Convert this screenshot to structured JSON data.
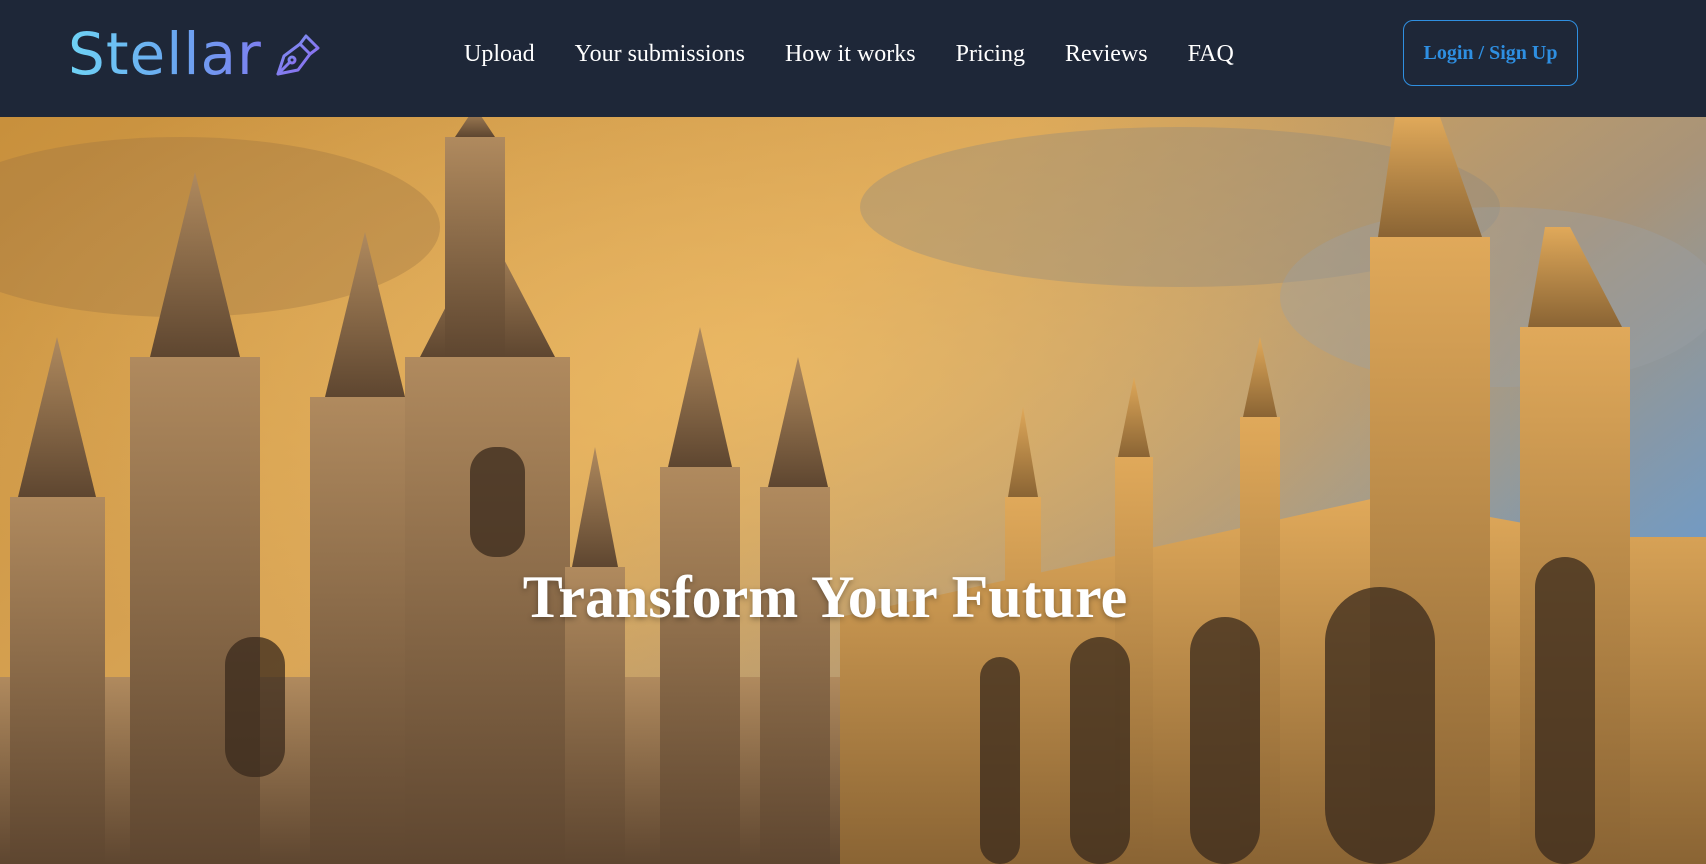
{
  "brand": {
    "name": "Stellar",
    "icon": "pen-nib-icon"
  },
  "nav": {
    "items": [
      {
        "label": "Upload"
      },
      {
        "label": "Your submissions"
      },
      {
        "label": "How it works"
      },
      {
        "label": "Pricing"
      },
      {
        "label": "Reviews"
      },
      {
        "label": "FAQ"
      }
    ]
  },
  "auth": {
    "login_label": "Login / Sign Up"
  },
  "hero": {
    "title": "Transform Your Future",
    "image": "gothic-college-architecture-sunset"
  },
  "colors": {
    "navbar_bg": "#1e2738",
    "accent_blue": "#2e8fe2",
    "logo_gradient_start": "#6fd3f5",
    "logo_gradient_end": "#7d7ff0"
  }
}
